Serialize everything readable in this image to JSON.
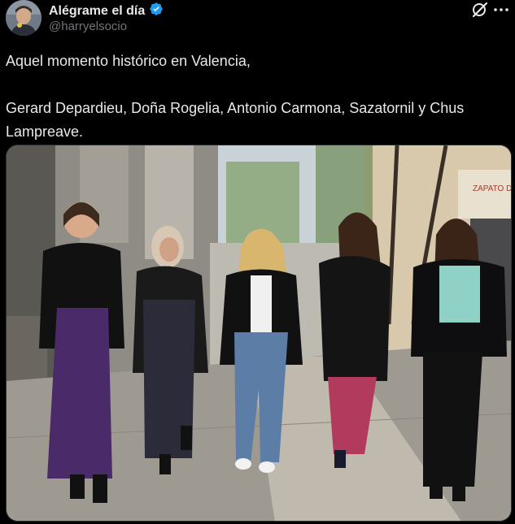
{
  "tweet": {
    "author": {
      "display_name": "Alégrame el día",
      "handle": "@harryelsocio",
      "verified": true,
      "verified_color": "#1d9bf0"
    },
    "header_icons": {
      "left": "grok-icon",
      "right": "more-icon"
    },
    "text": {
      "line1": "Aquel momento histórico en Valencia,",
      "line2": "Gerard Depardieu, Doña Rogelia, Antonio Carmona, Sazatornil y Chus Lampreave."
    },
    "media": {
      "sign_text": "ZAPATO DE",
      "alt": ""
    }
  },
  "colors": {
    "background": "#000000",
    "text_primary": "#e7e9ea",
    "text_secondary": "#71767b",
    "accent": "#1d9bf0"
  }
}
